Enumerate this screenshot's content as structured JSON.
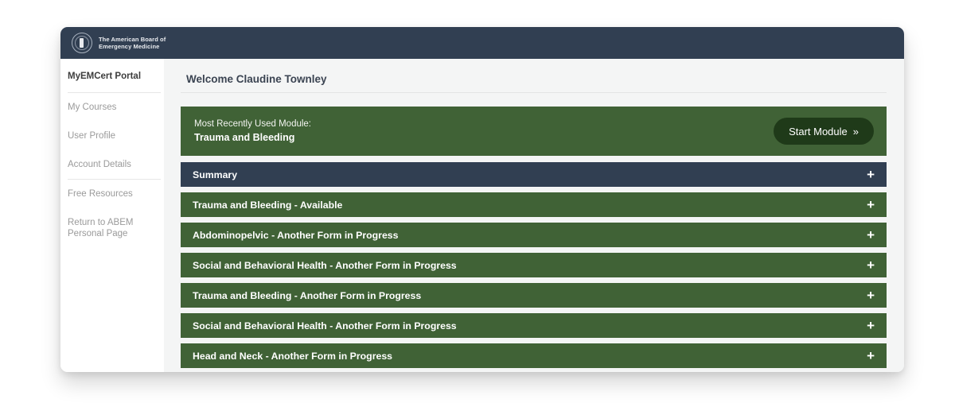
{
  "header": {
    "logo_line1": "The American Board of",
    "logo_line2": "Emergency Medicine",
    "logo_icon": "abem-seal-icon",
    "background_color": "#313f52"
  },
  "sidebar": {
    "items": [
      {
        "label": "MyEMCert Portal",
        "primary": true
      },
      {
        "label": "My Courses",
        "primary": false
      },
      {
        "label": "User Profile",
        "primary": false
      },
      {
        "label": "Account Details",
        "primary": false
      },
      {
        "label": "Free Resources",
        "primary": false
      },
      {
        "label": "Return to ABEM\nPersonal Page",
        "primary": false
      }
    ]
  },
  "main": {
    "welcome": "Welcome Claudine Townley",
    "recent": {
      "label": "Most Recently Used Module:",
      "module": "Trauma and Bleeding",
      "button_label": "Start Module",
      "button_chevron": "»",
      "background_color": "#406236",
      "button_color": "#1f3a19"
    },
    "accordion": {
      "expand_icon": "+",
      "green_color": "#406236",
      "navy_color": "#313f52",
      "rows": [
        {
          "label": "Summary",
          "style": "navy"
        },
        {
          "label": "Trauma and Bleeding - Available",
          "style": "green"
        },
        {
          "label": "Abdominopelvic - Another Form in Progress",
          "style": "green"
        },
        {
          "label": "Social and Behavioral Health - Another Form in Progress",
          "style": "green"
        },
        {
          "label": "Trauma and Bleeding - Another Form in Progress",
          "style": "green"
        },
        {
          "label": "Social and Behavioral Health - Another Form in Progress",
          "style": "green"
        },
        {
          "label": "Head and Neck - Another Form in Progress",
          "style": "green"
        }
      ]
    }
  }
}
